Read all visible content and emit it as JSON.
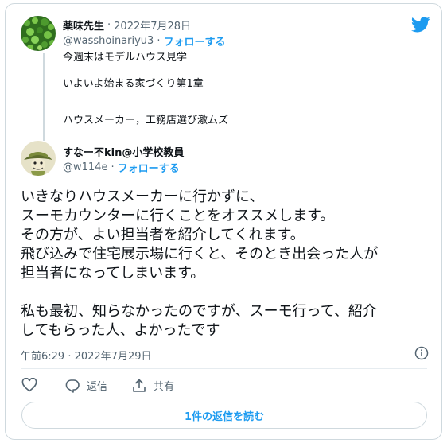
{
  "colors": {
    "accent": "#1d9bf0",
    "text": "#0f1419",
    "muted": "#536471",
    "border": "#cfd9de"
  },
  "tweet1": {
    "name": "薬味先生",
    "separator": "·",
    "date": "2022年7月28日",
    "handle": "@wasshoinariyu3",
    "follow": "フォローする",
    "lines": [
      "今週末はモデルハウス見学",
      "いよいよ始まる家づくり第1章",
      "ハウスメーカー，工務店選び激ムズ"
    ]
  },
  "tweet2": {
    "name": "すなー不kin@小学校教員",
    "handle": "@w114e",
    "follow": "フォローする",
    "text": "いきなりハウスメーカーに行かずに、\nスーモカウンターに行くことをオススメします。\nその方が、よい担当者を紹介してくれます。\n飛び込みで住宅展示場に行くと、そのとき出会った人が\n担当者になってしまいます。\n\n私も最初、知らなかったのですが、スーモ行って、紹介\nしてもらった人、よかったです",
    "timestamp": "午前6:29 · 2022年7月29日"
  },
  "actions": {
    "reply": "返信",
    "share": "共有"
  },
  "icons": {
    "bird": "twitter-bird-icon",
    "info": "info-icon",
    "like": "heart-icon",
    "reply": "reply-icon",
    "share": "share-icon"
  },
  "read_replies": "1件の返信を読む"
}
